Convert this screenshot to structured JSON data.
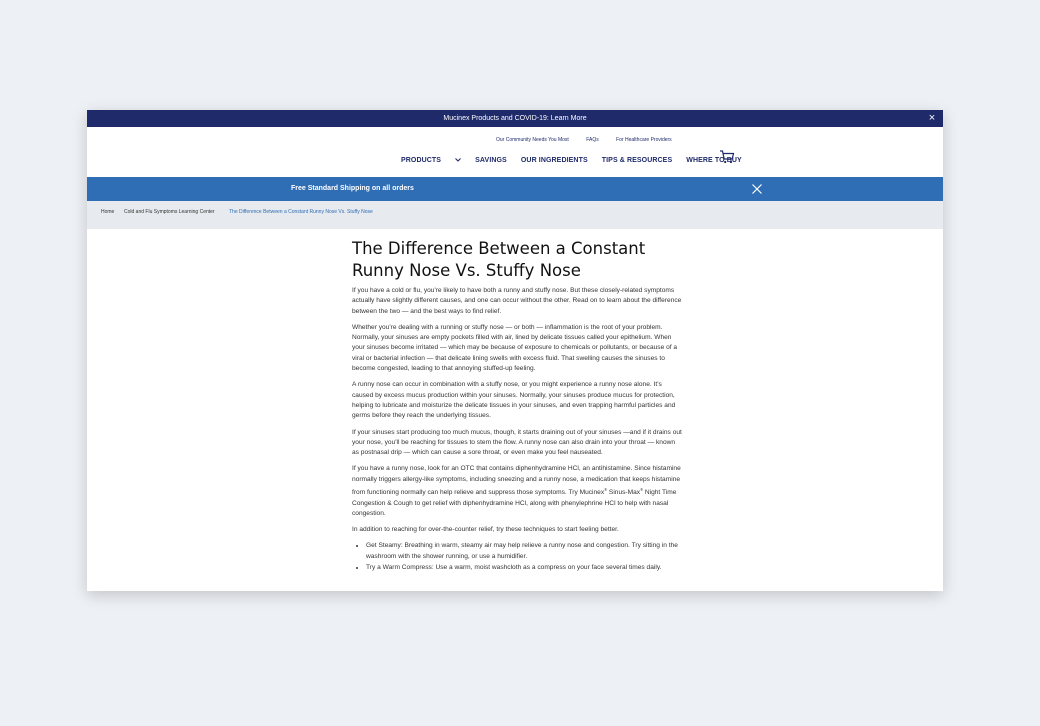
{
  "alert": {
    "text": "Mucinex Products and COVID-19: Learn More",
    "close": "×"
  },
  "utility_links": [
    "Our Community Needs You Most",
    "FAQs",
    "For Healthcare Providers"
  ],
  "nav": {
    "products": "PRODUCTS",
    "savings": "SAVINGS",
    "ingredients": "OUR INGREDIENTS",
    "tips": "TIPS & RESOURCES",
    "where": "WHERE TO BUY"
  },
  "icons": {
    "cart": "cart-icon",
    "close": "close-icon",
    "chevron": "chevron-down-icon"
  },
  "shipping": {
    "text": "Free Standard Shipping on all orders"
  },
  "breadcrumb": {
    "home": "Home",
    "center": "Cold and Flu Symptoms Learning Center",
    "current": "The Difference Between a Constant Runny Nose Vs. Stuffy Nose"
  },
  "article": {
    "title_line1": "The Difference Between a Constant",
    "title_line2": "Runny Nose Vs. Stuffy Nose",
    "p1": "If you have a cold or flu, you're likely to have both a runny and stuffy nose. But these closely-related symptoms actually have slightly different causes, and one can occur without the other. Read on to learn about the difference between the two — and the best ways to find relief.",
    "p2": "Whether you're dealing with a running or stuffy nose — or both — inflammation is the root of your problem. Normally, your sinuses are empty pockets filled with air, lined by delicate tissues called your epithelium. When your sinuses become irritated — which may be because of exposure to chemicals or pollutants, or because of a viral or bacterial infection — that delicate lining swells with excess fluid. That swelling causes the sinuses to become congested, leading to that annoying stuffed-up feeling.",
    "p3": "A runny nose can occur in combination with a stuffy nose, or you might experience a runny nose alone. It's caused by excess mucus production within your sinuses. Normally, your sinuses produce mucus for protection, helping to lubricate and moisturize the delicate tissues in your sinuses, and even trapping harmful particles and germs before they reach the underlying tissues.",
    "p4": "If your sinuses start producing too much mucus, though, it starts draining out of your sinuses —and if it drains out your nose, you'll be reaching for tissues to stem the flow. A runny nose can also drain into your throat — known as postnasal drip — which can cause a sore throat, or even make you feel nauseated.",
    "p5_a": "If you have a runny nose, look for an OTC that contains diphenhydramine HCl, an antihistamine. Since histamine normally triggers allergy-like symptoms, including sneezing and a runny nose, a medication that keeps histamine from functioning normally can help relieve and suppress those symptoms. Try Mucinex",
    "p5_reg1": "®",
    "p5_b": " Sinus-Max",
    "p5_reg2": "®",
    "p5_c": " Night Time Congestion & Cough to get relief with diphenhydramine HCl, along with phenylephrine HCl to help with nasal congestion.",
    "p6": "In addition to reaching for over-the-counter relief, try these techniques to start feeling better.",
    "bullet1": "Get Steamy: Breathing in warm, steamy air may help relieve a runny nose and congestion. Try sitting in the washroom with the shower running, or use a humidifier.",
    "bullet2": "Try a Warm Compress: Use a warm, moist washcloth as a compress on your face several times daily."
  }
}
